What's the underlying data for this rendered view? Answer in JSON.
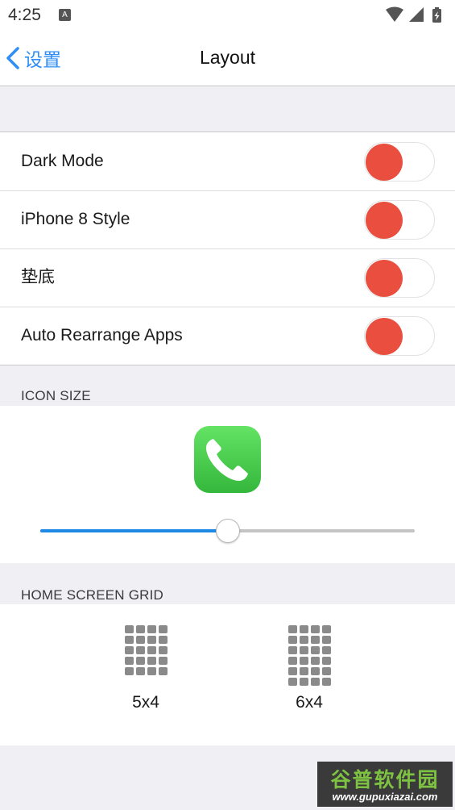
{
  "status_bar": {
    "time": "4:25",
    "notification_letter": "A"
  },
  "nav": {
    "back_label": "设置",
    "title": "Layout"
  },
  "settings": [
    {
      "label": "Dark Mode",
      "enabled": false
    },
    {
      "label": "iPhone 8 Style",
      "enabled": false
    },
    {
      "label": "垫底",
      "enabled": false
    },
    {
      "label": "Auto Rearrange Apps",
      "enabled": false
    }
  ],
  "icon_size": {
    "header": "ICON SIZE",
    "slider_value_fraction": 0.5,
    "icon": "phone-icon"
  },
  "home_screen_grid": {
    "header": "HOME SCREEN GRID",
    "options": [
      {
        "label": "5x4",
        "rows": 5,
        "cols": 4
      },
      {
        "label": "6x4",
        "rows": 6,
        "cols": 4
      }
    ]
  },
  "watermark": {
    "text_cn": "谷普软件园",
    "url": "www.gupuxiazai.com"
  },
  "colors": {
    "accent_blue": "#2f8ef5",
    "slider_blue": "#1e88e5",
    "toggle_off_knob": "#e94e3e",
    "app_icon_green": "#4cd964"
  }
}
